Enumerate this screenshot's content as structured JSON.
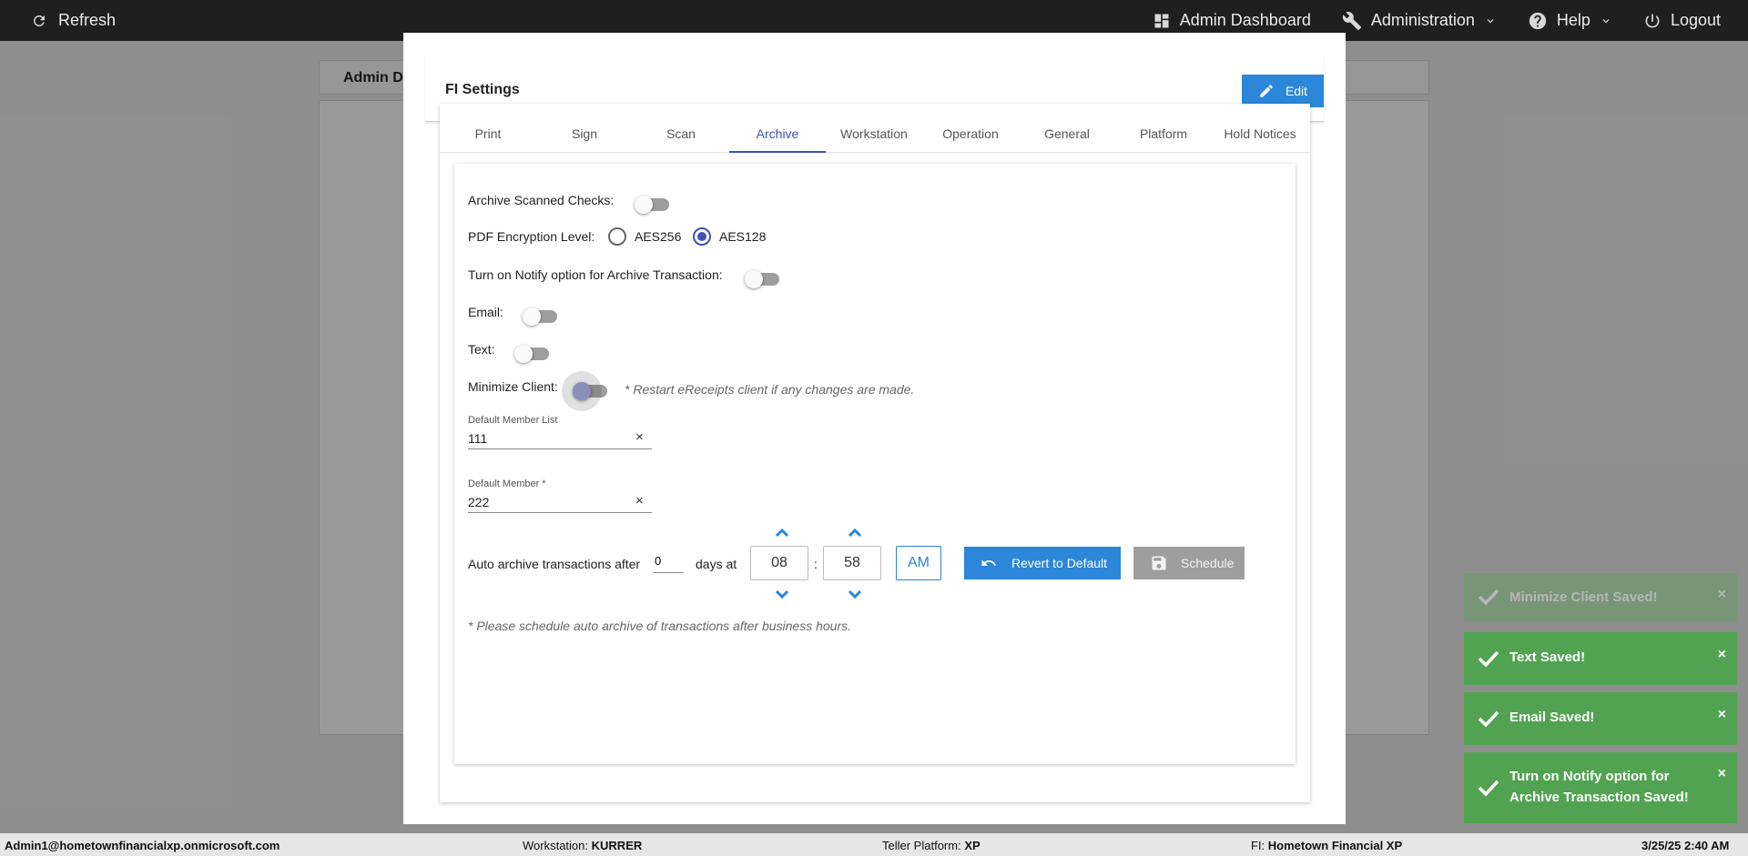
{
  "topbar": {
    "refresh": "Refresh",
    "admin_dashboard": "Admin Dashboard",
    "administration": "Administration",
    "help": "Help",
    "logout": "Logout"
  },
  "background": {
    "panel_title": "Admin D"
  },
  "modal": {
    "title": "FI Settings",
    "edit_label": "Edit",
    "tabs": [
      "Print",
      "Sign",
      "Scan",
      "Archive",
      "Workstation",
      "Operation",
      "General",
      "Platform",
      "Hold Notices"
    ],
    "active_tab": "Archive"
  },
  "archive": {
    "archive_scanned_checks_label": "Archive Scanned Checks:",
    "archive_scanned_checks_on": false,
    "pdf_encryption_label": "PDF Encryption Level:",
    "pdf_options": [
      "AES256",
      "AES128"
    ],
    "pdf_selected": "AES128",
    "notify_label": "Turn on Notify option for Archive Transaction:",
    "notify_on": false,
    "email_label": "Email:",
    "email_on": false,
    "text_label": "Text:",
    "text_on": false,
    "minimize_label": "Minimize Client:",
    "minimize_on": false,
    "restart_hint": "* Restart eReceipts client if any changes are made.",
    "default_member_list_label": "Default Member List",
    "default_member_list_value": "111",
    "default_member_label": "Default Member *",
    "default_member_value": "222",
    "auto_archive_prefix": "Auto archive transactions after",
    "days_value": "0",
    "days_at": "days at",
    "hour": "08",
    "colon": ":",
    "minute": "58",
    "ampm": "AM",
    "revert_label": "Revert to Default",
    "schedule_label": "Schedule",
    "schedule_hint": "* Please schedule auto archive of transactions after business hours."
  },
  "toasts": [
    {
      "lines": [
        "Minimize Client Saved!"
      ],
      "fading": true
    },
    {
      "lines": [
        "Text Saved!"
      ],
      "fading": false
    },
    {
      "lines": [
        "Email Saved!"
      ],
      "fading": false
    },
    {
      "lines": [
        "Turn on Notify option for",
        "Archive Transaction Saved!"
      ],
      "fading": false
    }
  ],
  "toast_close": "×",
  "clear_glyph": "×",
  "statusbar": {
    "user": "Admin1@hometownfinancialxp.onmicrosoft.com",
    "workstation_label": "Workstation:",
    "workstation_value": "KURRER",
    "teller_label": "Teller Platform:",
    "teller_value": "XP",
    "fi_label": "FI:",
    "fi_value": "Hometown Financial XP",
    "datetime": "3/25/25 2:40 AM"
  },
  "colors": {
    "accent": "#2c86d9",
    "tab_active": "#3f51b5",
    "toast_success": "#51a351",
    "topbar": "#1f1f1f"
  }
}
